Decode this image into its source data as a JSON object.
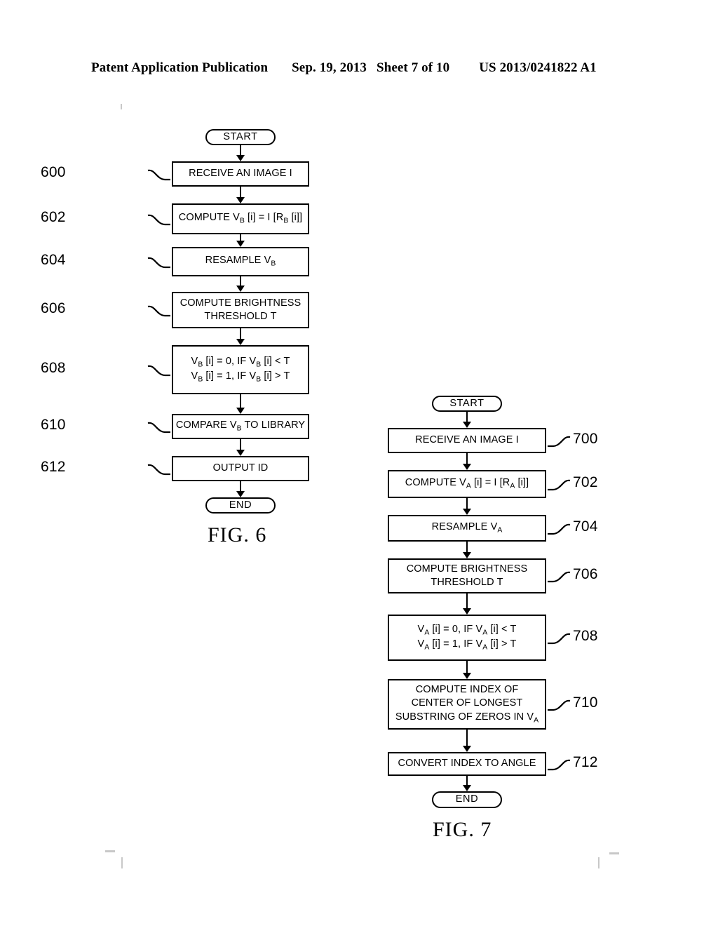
{
  "header": {
    "publication": "Patent Application Publication",
    "date": "Sep. 19, 2013",
    "sheet": "Sheet 7 of 10",
    "patent_number": "US 2013/0241822 A1"
  },
  "figures": [
    {
      "caption": "FIG. 6",
      "start_label": "START",
      "end_label": "END",
      "ref_side": "left",
      "steps": [
        {
          "ref": "600",
          "lines": [
            "RECEIVE AN IMAGE I"
          ]
        },
        {
          "ref": "602",
          "lines": [
            "COMPUTE V<sub>B</sub> [i] = I [R<sub>B</sub> [i]]"
          ]
        },
        {
          "ref": "604",
          "lines": [
            "RESAMPLE V<sub>B</sub>"
          ]
        },
        {
          "ref": "606",
          "lines": [
            "COMPUTE BRIGHTNESS",
            "THRESHOLD T"
          ]
        },
        {
          "ref": "608",
          "lines": [
            "V<sub>B</sub> [i] = 0, IF V<sub>B</sub> [i] &lt; T",
            "V<sub>B</sub> [i] = 1, IF V<sub>B</sub> [i] &gt; T"
          ]
        },
        {
          "ref": "610",
          "lines": [
            "COMPARE V<sub>B</sub> TO LIBRARY"
          ]
        },
        {
          "ref": "612",
          "lines": [
            "OUTPUT ID"
          ]
        }
      ]
    },
    {
      "caption": "FIG. 7",
      "start_label": "START",
      "end_label": "END",
      "ref_side": "right",
      "steps": [
        {
          "ref": "700",
          "lines": [
            "RECEIVE AN IMAGE I"
          ]
        },
        {
          "ref": "702",
          "lines": [
            "COMPUTE V<sub>A</sub> [i] = I [R<sub>A</sub> [i]]"
          ]
        },
        {
          "ref": "704",
          "lines": [
            "RESAMPLE V<sub>A</sub>"
          ]
        },
        {
          "ref": "706",
          "lines": [
            "COMPUTE BRIGHTNESS",
            "THRESHOLD T"
          ]
        },
        {
          "ref": "708",
          "lines": [
            "V<sub>A</sub> [i] = 0, IF V<sub>A</sub> [i] &lt; T",
            "V<sub>A</sub> [i] = 1, IF V<sub>A</sub> [i] &gt; T"
          ]
        },
        {
          "ref": "710",
          "lines": [
            "COMPUTE INDEX OF",
            "CENTER OF LONGEST",
            "SUBSTRING OF ZEROS IN V<sub>A</sub>"
          ]
        },
        {
          "ref": "712",
          "lines": [
            "CONVERT INDEX TO ANGLE"
          ]
        }
      ]
    }
  ]
}
